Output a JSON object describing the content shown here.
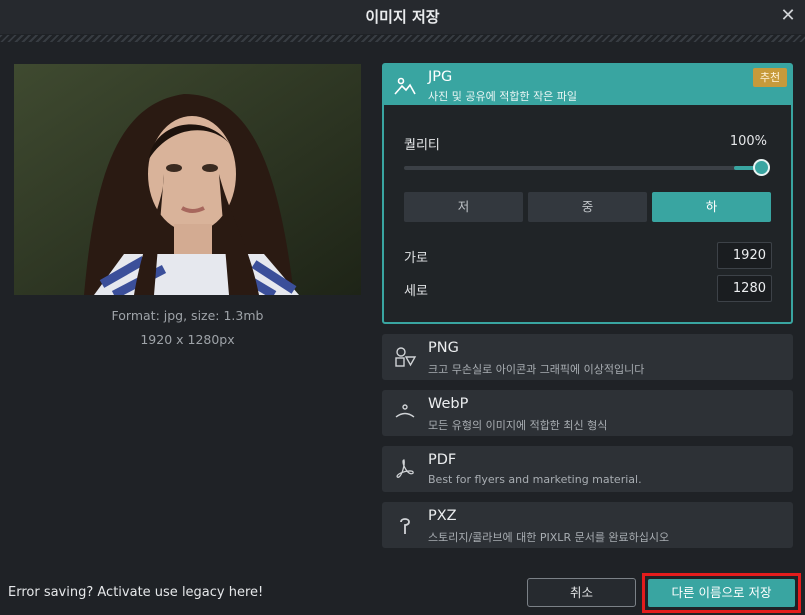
{
  "dialog": {
    "title": "이미지 저장",
    "close_label": "✕"
  },
  "preview": {
    "format_line": "Format: jpg, size: 1.3mb",
    "dimensions_line": "1920 x 1280px"
  },
  "formats": {
    "jpg": {
      "name": "JPG",
      "desc": "사진 및 공유에 적합한 작은 파일",
      "badge": "추천",
      "icon": "image-icon",
      "quality_label": "퀄리티",
      "quality_value": "100%",
      "quality_level": 1.0,
      "presets": [
        "저",
        "중",
        "하"
      ],
      "active_preset": "하",
      "width_label": "가로",
      "width_value": "1920",
      "height_label": "세로",
      "height_value": "1280"
    },
    "png": {
      "name": "PNG",
      "desc": "크고 무손실로 아이콘과 그래픽에 이상적입니다",
      "icon": "shapes-icon"
    },
    "webp": {
      "name": "WebP",
      "desc": "모든 유형의 이미지에 적합한 최신 형식",
      "icon": "smile-icon"
    },
    "pdf": {
      "name": "PDF",
      "desc": "Best for flyers and marketing material.",
      "icon": "pdf-icon"
    },
    "pxz": {
      "name": "PXZ",
      "desc": "스토리지/콜라브에 대한 PIXLR 문서를 완료하십시오",
      "icon": "pixlr-icon"
    }
  },
  "footer": {
    "legacy_text": "Error saving? Activate use legacy here!",
    "cancel_label": "취소",
    "save_as_label": "다른 이름으로 저장"
  },
  "colors": {
    "accent": "#39a5a1",
    "badge": "#c79a3b",
    "highlight": "#e31c1c"
  }
}
